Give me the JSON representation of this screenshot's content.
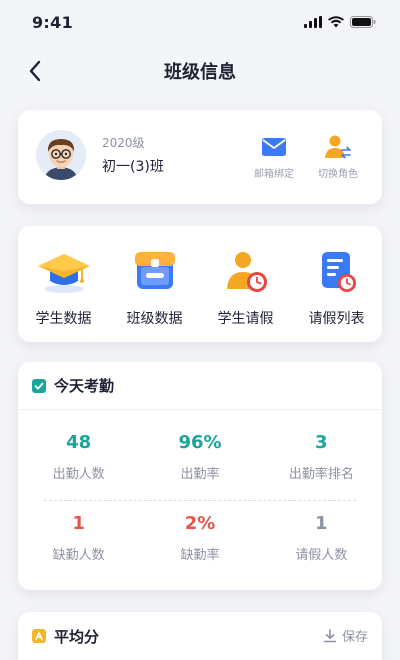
{
  "status": {
    "time": "9:41"
  },
  "nav": {
    "title": "班级信息"
  },
  "profile": {
    "grade": "2020级",
    "class_name": "初一(3)班",
    "actions": [
      {
        "label": "邮箱绑定",
        "icon": "mail-icon"
      },
      {
        "label": "切换角色",
        "icon": "switch-role-icon"
      }
    ]
  },
  "quick": [
    {
      "label": "学生数据",
      "icon": "graduation-cap-icon"
    },
    {
      "label": "班级数据",
      "icon": "class-box-icon"
    },
    {
      "label": "学生请假",
      "icon": "student-leave-icon"
    },
    {
      "label": "请假列表",
      "icon": "leave-list-icon"
    }
  ],
  "attendance": {
    "title": "今天考勤",
    "stats": [
      {
        "value": "48",
        "label": "出勤人数",
        "color": "#1aa59a"
      },
      {
        "value": "96%",
        "label": "出勤率",
        "color": "#1aa59a"
      },
      {
        "value": "3",
        "label": "出勤率排名",
        "color": "#1aa59a"
      },
      {
        "value": "1",
        "label": "缺勤人数",
        "color": "#e2574c"
      },
      {
        "value": "2%",
        "label": "缺勤率",
        "color": "#e2574c"
      },
      {
        "value": "1",
        "label": "请假人数",
        "color": "#8e93a3"
      }
    ]
  },
  "average": {
    "title": "平均分",
    "save_label": "保存"
  },
  "colors": {
    "accent_teal": "#1aa59a",
    "accent_red": "#e2574c",
    "brand_blue": "#3a7bf5"
  }
}
